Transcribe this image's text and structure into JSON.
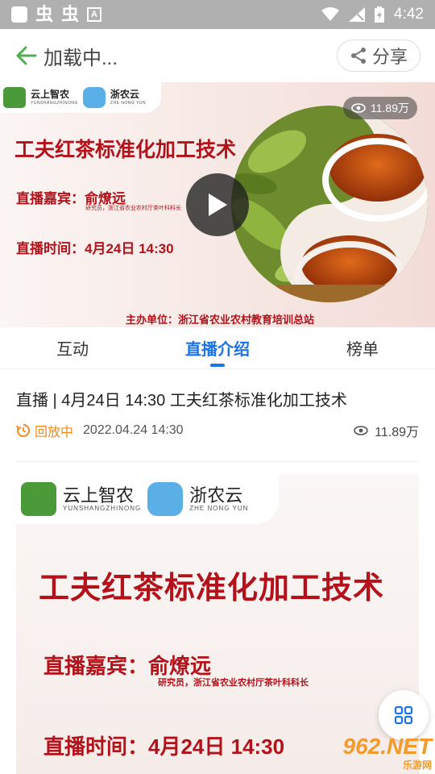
{
  "status_bar": {
    "time": "4:42",
    "a_label": "A",
    "bug1": "虫",
    "bug2": "虫"
  },
  "header": {
    "title": "加载中...",
    "share_label": "分享"
  },
  "banner": {
    "logo1": "云上智农",
    "logo1_sub": "YUNSHANGZHINONG",
    "logo2": "浙农云",
    "logo2_sub": "ZHE NONG YUN",
    "title": "工夫红茶标准化加工技术",
    "guest": "直播嘉宾：俞燎远",
    "guest_sub": "研究员，浙江省农业农村厅茶叶科科长",
    "time": "直播时间：4月24日 14:30",
    "host": "主办单位：浙江省农业农村教育培训总站",
    "views": "11.89万"
  },
  "tabs": [
    {
      "label": "互动"
    },
    {
      "label": "直播介绍"
    },
    {
      "label": "榜单"
    }
  ],
  "info": {
    "title": "直播 | 4月24日 14:30 工夫红茶标准化加工技术",
    "status": "回放中",
    "date": "2022.04.24 14:30",
    "views": "11.89万"
  },
  "poster": {
    "logo1": "云上智农",
    "logo1_sub": "YUNSHANGZHINONG",
    "logo2": "浙农云",
    "logo2_sub": "ZHE NONG YUN",
    "title": "工夫红茶标准化加工技术",
    "guest": "直播嘉宾：俞燎远",
    "guest_sub": "研究员，浙江省农业农村厅茶叶科科长",
    "time": "直播时间：4月24日 14:30"
  },
  "watermark": {
    "main": "962.NET",
    "sub": "乐游网"
  },
  "colors": {
    "accent": "#1a73e8",
    "banner_red": "#b3121a",
    "status_orange": "#f08a1a"
  }
}
